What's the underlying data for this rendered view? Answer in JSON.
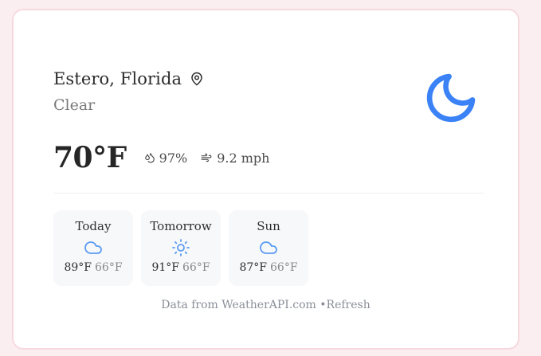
{
  "location": {
    "name": "Estero, Florida",
    "icon": "map-pin-icon"
  },
  "current": {
    "condition": "Clear",
    "condition_icon": "moon-icon",
    "temperature": "70°F",
    "humidity": "97%",
    "humidity_icon": "droplet-icon",
    "wind": "9.2 mph",
    "wind_icon": "wind-icon"
  },
  "forecast": [
    {
      "day": "Today",
      "icon": "cloud-icon",
      "high": "89°F",
      "low": "66°F"
    },
    {
      "day": "Tomorrow",
      "icon": "sun-icon",
      "high": "91°F",
      "low": "66°F"
    },
    {
      "day": "Sun",
      "icon": "cloud-icon",
      "high": "87°F",
      "low": "66°F"
    }
  ],
  "footer": {
    "source_text": "Data from WeatherAPI.com •",
    "refresh_label": "Refresh"
  },
  "colors": {
    "accent": "#3b82f6",
    "forecast_icon": "#5b9cf2",
    "card_border": "#f6d9df"
  }
}
